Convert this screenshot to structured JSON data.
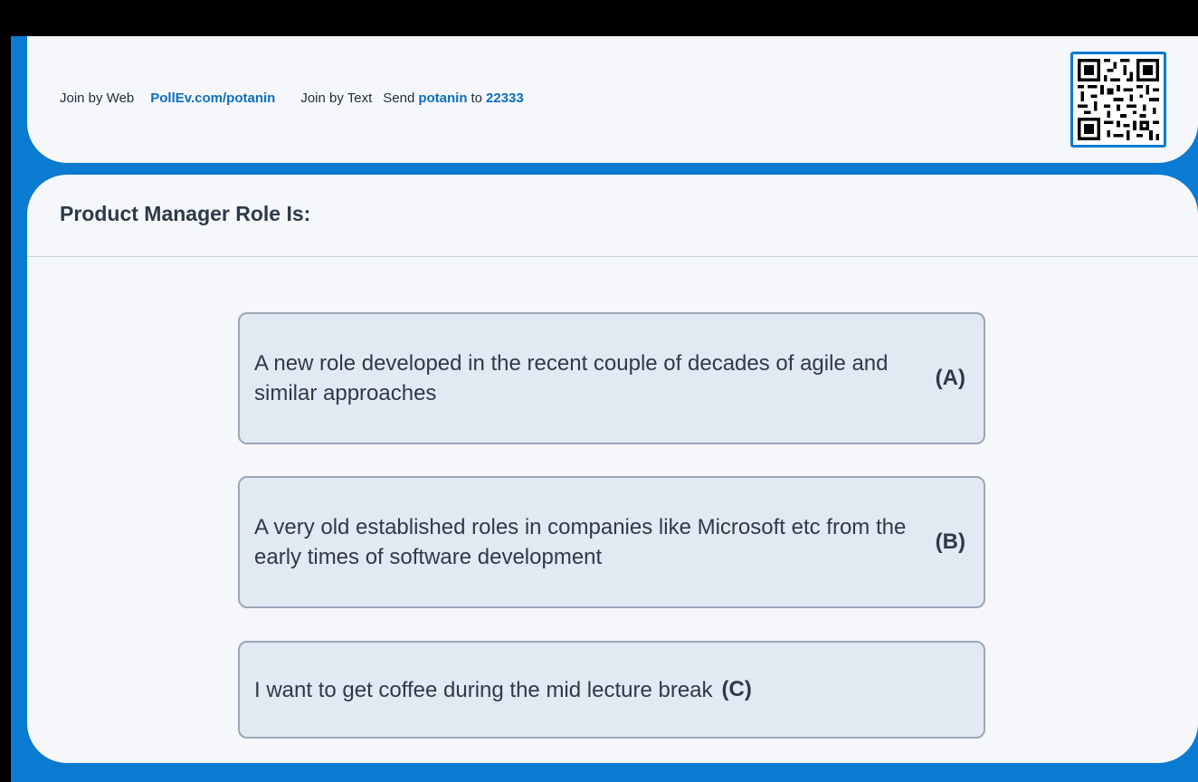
{
  "header": {
    "join_web_label": "Join by Web",
    "join_web_link": "PollEv.com/potanin",
    "join_text_label": "Join by Text",
    "send_label": "Send",
    "keyword": "potanin",
    "to_label": "to",
    "number": "22333"
  },
  "question": {
    "title": "Product Manager Role Is:"
  },
  "options": [
    {
      "text": "A new role developed in the recent couple of decades of agile and similar approaches",
      "key": "(A)"
    },
    {
      "text": "A very old established roles in companies like Microsoft etc from the early times of software development",
      "key": "(B)"
    },
    {
      "text": "I want to get coffee during the mid lecture break",
      "key": "(C)"
    }
  ],
  "colors": {
    "accent": "#0b7ad1",
    "link": "#0b6fc2",
    "card_background": "#f5f7fa",
    "option_background": "#e2e9f2",
    "option_border": "#9aa7b8",
    "text": "#2c3a4a"
  },
  "icons": {
    "qr": "qr-code-icon"
  }
}
